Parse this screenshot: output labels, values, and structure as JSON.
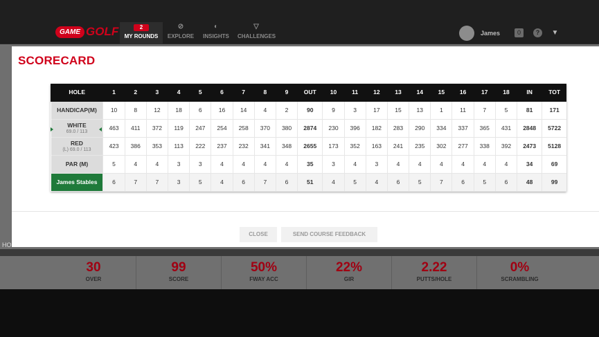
{
  "nav": {
    "logo_game": "GAME",
    "logo_golf": "GOLF",
    "rounds_badge": "2",
    "items": [
      {
        "label": "MY ROUNDS"
      },
      {
        "label": "EXPLORE"
      },
      {
        "label": "INSIGHTS"
      },
      {
        "label": "CHALLENGES"
      }
    ],
    "user_name": "James",
    "help_icon_glyph": "?",
    "msg_icon_glyph": "0"
  },
  "background": {
    "hole_label_partial": "HO"
  },
  "stats": [
    {
      "value": "30",
      "label": "OVER"
    },
    {
      "value": "99",
      "label": "SCORE"
    },
    {
      "value": "50%",
      "label": "FWAY ACC"
    },
    {
      "value": "22%",
      "label": "GIR"
    },
    {
      "value": "2.22",
      "label": "PUTTS/HOLE"
    },
    {
      "value": "0%",
      "label": "SCRAMBLING"
    }
  ],
  "modal": {
    "title": "SCORECARD",
    "close_label": "CLOSE",
    "feedback_label": "SEND COURSE FEEDBACK"
  },
  "scorecard": {
    "headers": [
      "HOLE",
      "1",
      "2",
      "3",
      "4",
      "5",
      "6",
      "7",
      "8",
      "9",
      "OUT",
      "10",
      "11",
      "12",
      "13",
      "14",
      "15",
      "16",
      "17",
      "18",
      "IN",
      "TOT"
    ],
    "rows": [
      {
        "label": "HANDICAP(M)",
        "sub": "",
        "values": [
          "10",
          "8",
          "12",
          "18",
          "6",
          "16",
          "14",
          "4",
          "2",
          "90",
          "9",
          "3",
          "17",
          "15",
          "13",
          "1",
          "11",
          "7",
          "5",
          "81",
          "171"
        ]
      },
      {
        "label": "WHITE",
        "sub": "69.0 / 113",
        "values": [
          "463",
          "411",
          "372",
          "119",
          "247",
          "254",
          "258",
          "370",
          "380",
          "2874",
          "230",
          "396",
          "182",
          "283",
          "290",
          "334",
          "337",
          "365",
          "431",
          "2848",
          "5722"
        ]
      },
      {
        "label": "RED",
        "sub": "(L) 69.0 / 113",
        "values": [
          "423",
          "386",
          "353",
          "113",
          "222",
          "237",
          "232",
          "341",
          "348",
          "2655",
          "173",
          "352",
          "163",
          "241",
          "235",
          "302",
          "277",
          "338",
          "392",
          "2473",
          "5128"
        ]
      },
      {
        "label": "PAR (M)",
        "sub": "",
        "values": [
          "5",
          "4",
          "4",
          "3",
          "3",
          "4",
          "4",
          "4",
          "4",
          "35",
          "3",
          "4",
          "3",
          "4",
          "4",
          "4",
          "4",
          "4",
          "4",
          "34",
          "69"
        ]
      },
      {
        "label": "James Stables",
        "sub": "",
        "values": [
          "6",
          "7",
          "7",
          "3",
          "5",
          "4",
          "6",
          "7",
          "6",
          "51",
          "4",
          "5",
          "4",
          "6",
          "5",
          "7",
          "6",
          "5",
          "6",
          "48",
          "99"
        ]
      }
    ]
  },
  "colors": {
    "brand_red": "#d0021b",
    "player_green": "#1f7a3a"
  }
}
